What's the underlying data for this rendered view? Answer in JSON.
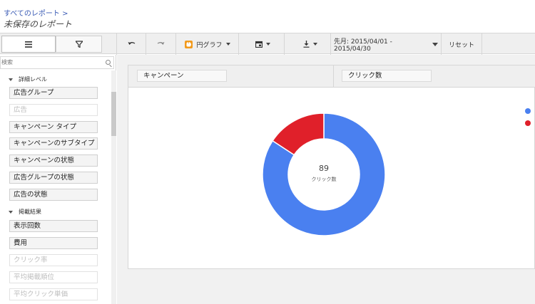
{
  "header": {
    "breadcrumb": "すべてのレポート >",
    "title": "未保存のレポート"
  },
  "toolbar": {
    "view_icon": "list-icon",
    "filter_icon": "filter-icon",
    "undo_icon": "undo-icon",
    "redo_icon": "redo-icon",
    "chart_type_label": "円グラフ",
    "calendar_icon": "calendar-icon",
    "download_icon": "download-icon",
    "date_range_label": "先月: 2015/04/01 - 2015/04/30",
    "reset_label": "リセット"
  },
  "sidebar": {
    "search_placeholder": "検索",
    "sections": [
      {
        "label": "詳細レベル",
        "items": [
          {
            "label": "広告グループ",
            "enabled": true
          },
          {
            "label": "広告",
            "enabled": false
          },
          {
            "label": "キャンペーン タイプ",
            "enabled": true
          },
          {
            "label": "キャンペーンのサブタイプ",
            "enabled": true
          },
          {
            "label": "キャンペーンの状態",
            "enabled": true
          },
          {
            "label": "広告グループの状態",
            "enabled": true
          },
          {
            "label": "広告の状態",
            "enabled": true
          }
        ]
      },
      {
        "label": "掲載結果",
        "items": [
          {
            "label": "表示回数",
            "enabled": true
          },
          {
            "label": "費用",
            "enabled": true
          },
          {
            "label": "クリック率",
            "enabled": false
          },
          {
            "label": "平均掲載順位",
            "enabled": false
          },
          {
            "label": "平均クリック単価",
            "enabled": false
          }
        ]
      }
    ]
  },
  "chart_panel": {
    "dimension_label": "キャンペーン",
    "metric_label": "クリック数"
  },
  "chart_data": {
    "type": "pie",
    "donut": true,
    "center_value": "89",
    "center_label": "クリック数",
    "slices": [
      {
        "value": 75,
        "color": "#4a80f0"
      },
      {
        "value": 14,
        "color": "#e0202a"
      }
    ],
    "total": 89
  }
}
